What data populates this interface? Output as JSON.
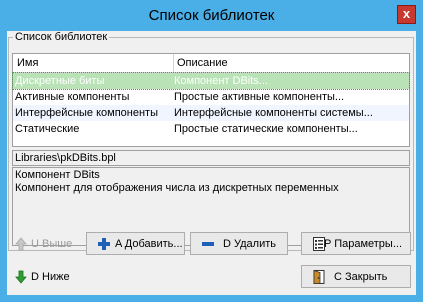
{
  "window": {
    "title": "Список библиотек",
    "close_glyph": "x"
  },
  "group": {
    "label": "Список библиотек"
  },
  "table": {
    "columns": [
      "Имя",
      "Описание"
    ],
    "rows": [
      {
        "name": "Дискретные биты",
        "description": "Компонент DBits..."
      },
      {
        "name": "Активные компоненты",
        "description": "Простые активные компоненты..."
      },
      {
        "name": "Интерфейсные компоненты",
        "description": "Интерфейсные компоненты системы..."
      },
      {
        "name": "Статические",
        "description": "Простые статические компоненты..."
      }
    ],
    "selected_index": 0
  },
  "details": {
    "path": "Libraries\\pkDBits.bpl",
    "title": "Компонент DBits",
    "text": "Компонент для отображения числа из дискретных переменных"
  },
  "buttons": {
    "up": "U Выше",
    "add": "A Добавить...",
    "delete": "D Удалить",
    "params": "P Параметры...",
    "down": "D Ниже",
    "close": "C Закрыть"
  },
  "icons": {
    "up": "arrow-up-icon",
    "add": "plus-icon",
    "delete": "minus-icon",
    "params": "settings-sheet-icon",
    "down": "arrow-down-icon",
    "close": "close-door-icon"
  },
  "colors": {
    "titlebar": "#4aaee7",
    "selection": "#b9e3b6",
    "close_button": "#c7382f"
  }
}
